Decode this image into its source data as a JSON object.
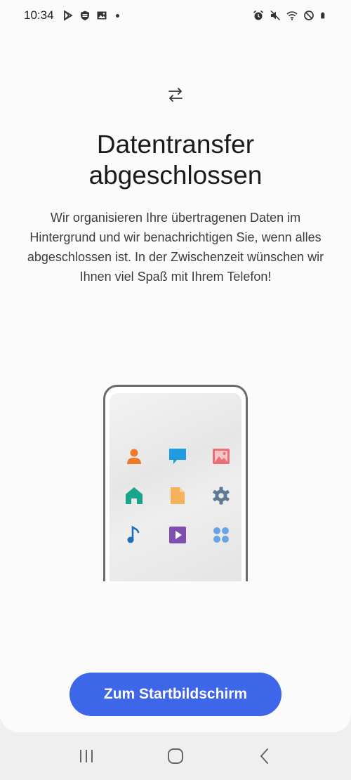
{
  "status_bar": {
    "time": "10:34",
    "left_icons": [
      "play-store-icon",
      "security-shield-icon",
      "gallery-icon",
      "notification-dot"
    ],
    "right_icons": [
      "alarm-icon",
      "mute-icon",
      "wifi-icon",
      "do-not-disturb-icon",
      "battery-icon"
    ]
  },
  "header": {
    "icon": "transfer-arrows-icon",
    "title_line1": "Datentransfer",
    "title_line2": "abgeschlossen"
  },
  "description": "Wir organisieren Ihre übertragenen Daten im Hintergrund und wir benachrichtigen Sie, wenn alles abgeschlossen ist. In der Zwischenzeit wünschen wir Ihnen viel Spaß mit Ihrem Telefon!",
  "illustration": {
    "apps": [
      {
        "name": "contact-icon",
        "color": "#f07a2c"
      },
      {
        "name": "message-icon",
        "color": "#1e9de3"
      },
      {
        "name": "image-icon",
        "color": "#ea6f76"
      },
      {
        "name": "home-icon",
        "color": "#1aa48a"
      },
      {
        "name": "document-icon",
        "color": "#f4b35a"
      },
      {
        "name": "settings-icon",
        "color": "#5e7a92"
      },
      {
        "name": "music-icon",
        "color": "#1d6fb7"
      },
      {
        "name": "video-icon",
        "color": "#7e4fb0"
      },
      {
        "name": "apps-icon",
        "color": "#6aa3e3"
      }
    ]
  },
  "actions": {
    "primary_label": "Zum Startbildschirm"
  },
  "colors": {
    "accent": "#3e66e8",
    "background": "#fbfbfb"
  },
  "nav_bar": {
    "buttons": [
      "recents-icon",
      "home-button-icon",
      "back-icon"
    ]
  }
}
